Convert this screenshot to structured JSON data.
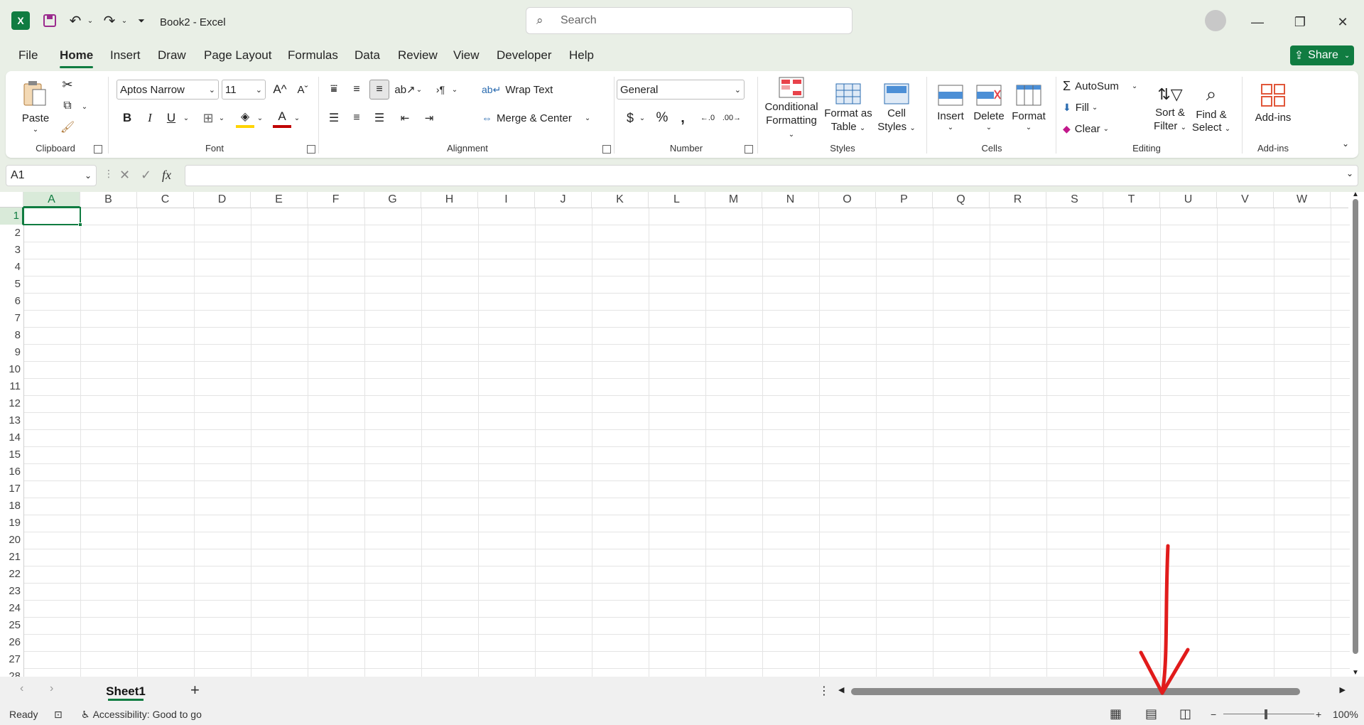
{
  "app": {
    "doc_title": "Book2  -  Excel",
    "search_placeholder": "Search",
    "share_label": "Share"
  },
  "tabs": [
    "File",
    "Home",
    "Insert",
    "Draw",
    "Page Layout",
    "Formulas",
    "Data",
    "Review",
    "View",
    "Developer",
    "Help"
  ],
  "active_tab": "Home",
  "ribbon": {
    "clipboard": {
      "paste": "Paste",
      "label": "Clipboard"
    },
    "font": {
      "family": "Aptos Narrow",
      "size": "11",
      "label": "Font"
    },
    "alignment": {
      "wrap_text": "Wrap Text",
      "merge_center": "Merge & Center",
      "label": "Alignment"
    },
    "number": {
      "format": "General",
      "label": "Number"
    },
    "styles": {
      "conditional": "Conditional",
      "conditional2": "Formatting",
      "format_as": "Format as",
      "format_as2": "Table",
      "cell": "Cell",
      "cell2": "Styles",
      "label": "Styles"
    },
    "cells": {
      "insert": "Insert",
      "delete": "Delete",
      "format": "Format",
      "label": "Cells"
    },
    "editing": {
      "autosum": "AutoSum",
      "fill": "Fill",
      "clear": "Clear",
      "sort": "Sort &",
      "sort2": "Filter",
      "find": "Find &",
      "find2": "Select",
      "label": "Editing"
    },
    "addins": {
      "addins": "Add-ins",
      "label": "Add-ins"
    }
  },
  "formula_bar": {
    "name_box": "A1",
    "formula": ""
  },
  "grid": {
    "columns": [
      "A",
      "B",
      "C",
      "D",
      "E",
      "F",
      "G",
      "H",
      "I",
      "J",
      "K",
      "L",
      "M",
      "N",
      "O",
      "P",
      "Q",
      "R",
      "S",
      "T",
      "U",
      "V",
      "W"
    ],
    "rows": [
      "1",
      "2",
      "3",
      "4",
      "5",
      "6",
      "7",
      "8",
      "9",
      "10",
      "11",
      "12",
      "13",
      "14",
      "15",
      "16",
      "17",
      "18",
      "19",
      "20",
      "21",
      "22",
      "23",
      "24",
      "25",
      "26",
      "27",
      "28"
    ],
    "selected_cell": "A1"
  },
  "sheets": {
    "active": "Sheet1"
  },
  "status": {
    "ready": "Ready",
    "accessibility": "Accessibility: Good to go",
    "zoom": "100%"
  },
  "colors": {
    "accent": "#107c41",
    "annotation": "#e11b1b"
  }
}
